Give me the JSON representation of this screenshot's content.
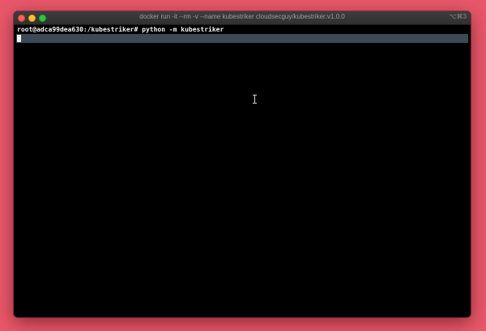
{
  "window": {
    "title": "docker run -it --rm -v  --name kubestriker cloudsecguy/kubestriker:v1.0.0",
    "shortcut": "⌥⌘3",
    "traffic_lights": [
      "close",
      "minimize",
      "maximize"
    ]
  },
  "terminal": {
    "prompt_line": "root@adca99dea630:/kubestriker# python -m kubestriker",
    "cursor_icon": "text-cursor-icon"
  },
  "colors": {
    "background": "#e8586a",
    "terminal_bg": "#000000",
    "active_line": "#3b4a54",
    "text": "#f2f2f2"
  }
}
